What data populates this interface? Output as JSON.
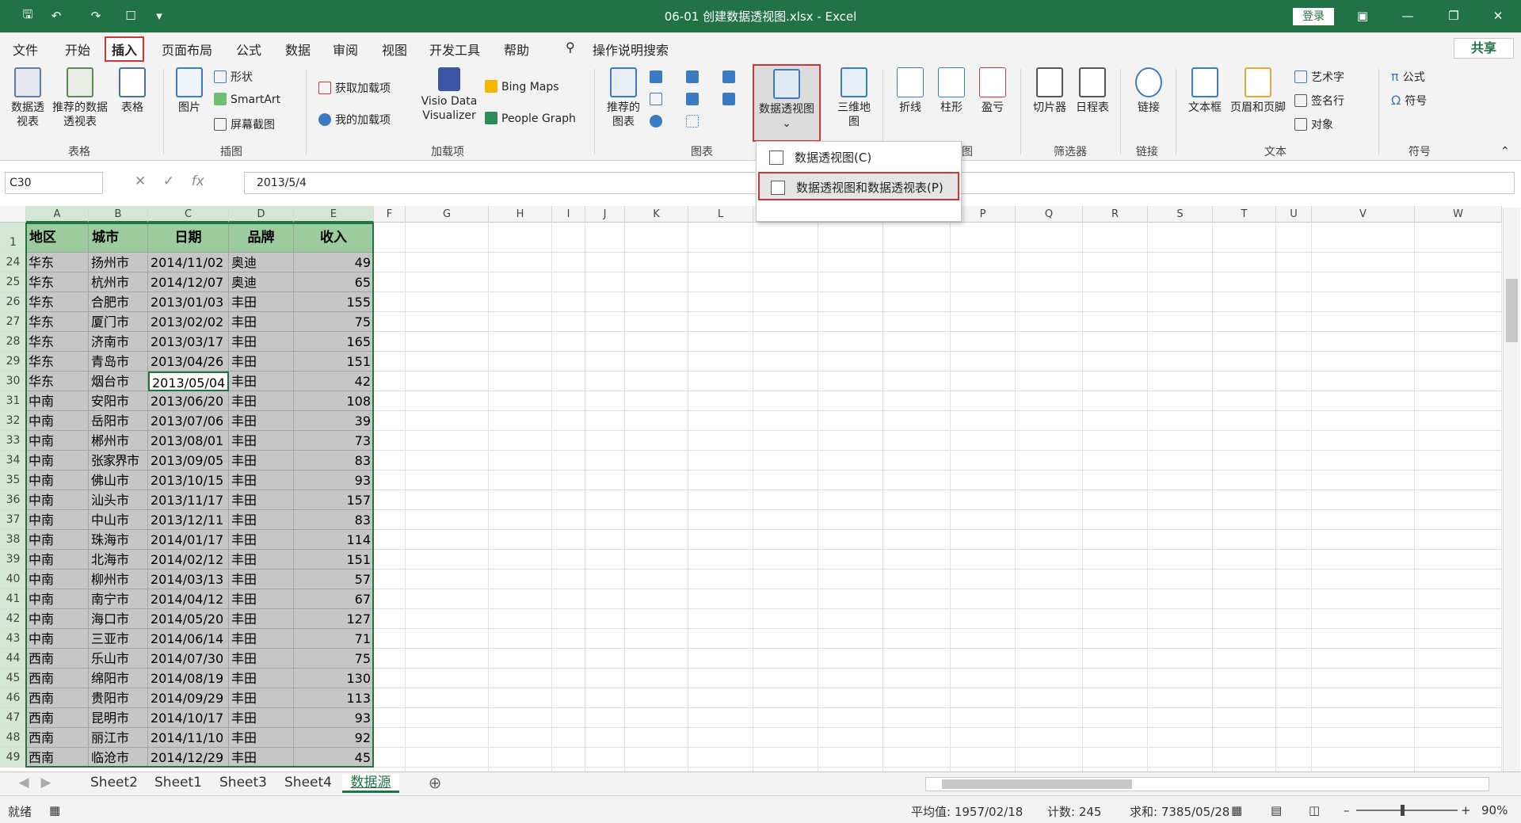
{
  "app": {
    "title": "06-01 创建数据透视图.xlsx  -  Excel",
    "login": "登录",
    "share": "共享"
  },
  "menu": [
    "文件",
    "开始",
    "插入",
    "页面布局",
    "公式",
    "数据",
    "审阅",
    "视图",
    "开发工具",
    "帮助",
    "操作说明搜索"
  ],
  "ribbon": {
    "pivot_table": "数据透视表",
    "recommended_pivot": "推荐的数据透视表",
    "table": "表格",
    "picture": "图片",
    "shapes": "形状",
    "smartart": "SmartArt",
    "screenshot": "屏幕截图",
    "get_addins": "获取加载项",
    "my_addins": "我的加载项",
    "visio": "Visio Data Visualizer",
    "bing_maps": "Bing Maps",
    "people_graph": "People Graph",
    "recommended_charts": "推荐的图表",
    "pivot_chart": "数据透视图",
    "map3d": "三维地图",
    "line": "折线",
    "column": "柱形",
    "winloss": "盈亏",
    "slicer": "切片器",
    "timeline": "日程表",
    "link": "链接",
    "textbox": "文本框",
    "header_footer": "页眉和页脚",
    "wordart": "艺术字",
    "signature": "签名行",
    "object": "对象",
    "equation": "公式",
    "symbol": "符号",
    "groups": {
      "tables": "表格",
      "illustrations": "插图",
      "addins": "加载项",
      "charts": "图表",
      "sparklines": "图",
      "filters": "筛选器",
      "links": "链接",
      "text": "文本",
      "symbols": "符号"
    }
  },
  "dropdown": {
    "item1": "数据透视图(C)",
    "item2": "数据透视图和数据透视表(P)"
  },
  "formula": {
    "namebox": "C30",
    "content": "2013/5/4",
    "fx": "fx"
  },
  "columns": [
    "A",
    "B",
    "C",
    "D",
    "E",
    "F",
    "G",
    "H",
    "I",
    "J",
    "K",
    "L",
    "M",
    "N",
    "O",
    "P",
    "Q",
    "R",
    "S",
    "T",
    "U",
    "V",
    "W"
  ],
  "header": {
    "row": "1",
    "cells": [
      "地区",
      "城市",
      "日期",
      "品牌",
      "收入"
    ]
  },
  "rows": [
    {
      "n": "24",
      "a": "华东",
      "b": "扬州市",
      "c": "2014/11/02",
      "d": "奥迪",
      "e": "49"
    },
    {
      "n": "25",
      "a": "华东",
      "b": "杭州市",
      "c": "2014/12/07",
      "d": "奥迪",
      "e": "65"
    },
    {
      "n": "26",
      "a": "华东",
      "b": "合肥市",
      "c": "2013/01/03",
      "d": "丰田",
      "e": "155"
    },
    {
      "n": "27",
      "a": "华东",
      "b": "厦门市",
      "c": "2013/02/02",
      "d": "丰田",
      "e": "75"
    },
    {
      "n": "28",
      "a": "华东",
      "b": "济南市",
      "c": "2013/03/17",
      "d": "丰田",
      "e": "165"
    },
    {
      "n": "29",
      "a": "华东",
      "b": "青岛市",
      "c": "2013/04/26",
      "d": "丰田",
      "e": "151"
    },
    {
      "n": "30",
      "a": "华东",
      "b": "烟台市",
      "c": "2013/05/04",
      "d": "丰田",
      "e": "42"
    },
    {
      "n": "31",
      "a": "中南",
      "b": "安阳市",
      "c": "2013/06/20",
      "d": "丰田",
      "e": "108"
    },
    {
      "n": "32",
      "a": "中南",
      "b": "岳阳市",
      "c": "2013/07/06",
      "d": "丰田",
      "e": "39"
    },
    {
      "n": "33",
      "a": "中南",
      "b": "郴州市",
      "c": "2013/08/01",
      "d": "丰田",
      "e": "73"
    },
    {
      "n": "34",
      "a": "中南",
      "b": "张家界市",
      "c": "2013/09/05",
      "d": "丰田",
      "e": "83"
    },
    {
      "n": "35",
      "a": "中南",
      "b": "佛山市",
      "c": "2013/10/15",
      "d": "丰田",
      "e": "93"
    },
    {
      "n": "36",
      "a": "中南",
      "b": "汕头市",
      "c": "2013/11/17",
      "d": "丰田",
      "e": "157"
    },
    {
      "n": "37",
      "a": "中南",
      "b": "中山市",
      "c": "2013/12/11",
      "d": "丰田",
      "e": "83"
    },
    {
      "n": "38",
      "a": "中南",
      "b": "珠海市",
      "c": "2014/01/17",
      "d": "丰田",
      "e": "114"
    },
    {
      "n": "39",
      "a": "中南",
      "b": "北海市",
      "c": "2014/02/12",
      "d": "丰田",
      "e": "151"
    },
    {
      "n": "40",
      "a": "中南",
      "b": "柳州市",
      "c": "2014/03/13",
      "d": "丰田",
      "e": "57"
    },
    {
      "n": "41",
      "a": "中南",
      "b": "南宁市",
      "c": "2014/04/12",
      "d": "丰田",
      "e": "67"
    },
    {
      "n": "42",
      "a": "中南",
      "b": "海口市",
      "c": "2014/05/20",
      "d": "丰田",
      "e": "127"
    },
    {
      "n": "43",
      "a": "中南",
      "b": "三亚市",
      "c": "2014/06/14",
      "d": "丰田",
      "e": "71"
    },
    {
      "n": "44",
      "a": "西南",
      "b": "乐山市",
      "c": "2014/07/30",
      "d": "丰田",
      "e": "75"
    },
    {
      "n": "45",
      "a": "西南",
      "b": "绵阳市",
      "c": "2014/08/19",
      "d": "丰田",
      "e": "130"
    },
    {
      "n": "46",
      "a": "西南",
      "b": "贵阳市",
      "c": "2014/09/29",
      "d": "丰田",
      "e": "113"
    },
    {
      "n": "47",
      "a": "西南",
      "b": "昆明市",
      "c": "2014/10/17",
      "d": "丰田",
      "e": "93"
    },
    {
      "n": "48",
      "a": "西南",
      "b": "丽江市",
      "c": "2014/11/10",
      "d": "丰田",
      "e": "92"
    },
    {
      "n": "49",
      "a": "西南",
      "b": "临沧市",
      "c": "2014/12/29",
      "d": "丰田",
      "e": "45"
    }
  ],
  "sheets": [
    "Sheet2",
    "Sheet1",
    "Sheet3",
    "Sheet4",
    "数据源"
  ],
  "status": {
    "ready": "就绪",
    "average": "平均值: 1957/02/18",
    "count": "计数: 245",
    "sum": "求和: 7385/05/28",
    "zoom": "90%"
  }
}
